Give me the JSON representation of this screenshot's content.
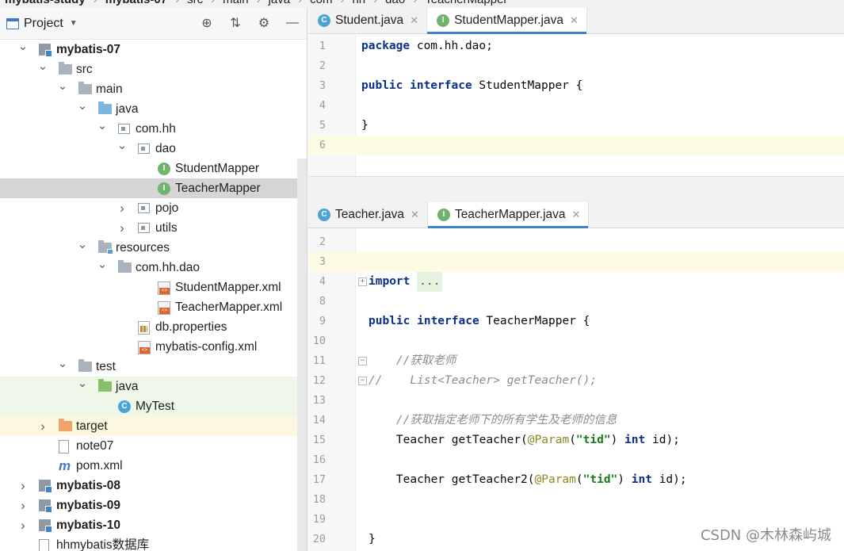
{
  "breadcrumb": [
    "mybatis-study",
    "mybatis-07",
    "src",
    "main",
    "java",
    "com",
    "hh",
    "dao",
    "TeacherMapper"
  ],
  "project_panel": {
    "title": "Project",
    "icons": [
      "window-icon",
      "locate-icon",
      "collapse-icon",
      "gear-icon",
      "minimize-icon"
    ]
  },
  "tree": [
    {
      "label": "mybatis-07",
      "depth": 0,
      "chevron": "down",
      "icon": "module",
      "bold": true
    },
    {
      "label": "src",
      "depth": 1,
      "chevron": "down",
      "icon": "folder"
    },
    {
      "label": "main",
      "depth": 2,
      "chevron": "down",
      "icon": "folder"
    },
    {
      "label": "java",
      "depth": 3,
      "chevron": "down",
      "icon": "folder-blue"
    },
    {
      "label": "com.hh",
      "depth": 4,
      "chevron": "down",
      "icon": "package"
    },
    {
      "label": "dao",
      "depth": 5,
      "chevron": "down",
      "icon": "package"
    },
    {
      "label": "StudentMapper",
      "depth": 6,
      "chevron": "",
      "icon": "interface"
    },
    {
      "label": "TeacherMapper",
      "depth": 6,
      "chevron": "",
      "icon": "interface",
      "state": "selected"
    },
    {
      "label": "pojo",
      "depth": 5,
      "chevron": "right",
      "icon": "package"
    },
    {
      "label": "utils",
      "depth": 5,
      "chevron": "right",
      "icon": "package"
    },
    {
      "label": "resources",
      "depth": 3,
      "chevron": "down",
      "icon": "folder-res"
    },
    {
      "label": "com.hh.dao",
      "depth": 4,
      "chevron": "down",
      "icon": "folder"
    },
    {
      "label": "StudentMapper.xml",
      "depth": 6,
      "chevron": "",
      "icon": "xml"
    },
    {
      "label": "TeacherMapper.xml",
      "depth": 6,
      "chevron": "",
      "icon": "xml"
    },
    {
      "label": "db.properties",
      "depth": 5,
      "chevron": "",
      "icon": "properties"
    },
    {
      "label": "mybatis-config.xml",
      "depth": 5,
      "chevron": "",
      "icon": "xml"
    },
    {
      "label": "test",
      "depth": 2,
      "chevron": "down",
      "icon": "folder"
    },
    {
      "label": "java",
      "depth": 3,
      "chevron": "down",
      "icon": "folder-green",
      "state": "test"
    },
    {
      "label": "MyTest",
      "depth": 4,
      "chevron": "",
      "icon": "class",
      "state": "test"
    },
    {
      "label": "target",
      "depth": 1,
      "chevron": "right",
      "icon": "folder-orange",
      "state": "excluded"
    },
    {
      "label": "note07",
      "depth": 1,
      "chevron": "",
      "icon": "file"
    },
    {
      "label": "pom.xml",
      "depth": 1,
      "chevron": "",
      "icon": "maven"
    },
    {
      "label": "mybatis-08",
      "depth": 0,
      "chevron": "right",
      "icon": "module",
      "bold": true
    },
    {
      "label": "mybatis-09",
      "depth": 0,
      "chevron": "right",
      "icon": "module",
      "bold": true
    },
    {
      "label": "mybatis-10",
      "depth": 0,
      "chevron": "right",
      "icon": "module",
      "bold": true
    },
    {
      "label": "hhmybatis数据库",
      "depth": 0,
      "chevron": "",
      "icon": "file"
    }
  ],
  "editor_top": {
    "tabs": [
      {
        "label": "Student.java",
        "kind": "c",
        "active": false
      },
      {
        "label": "StudentMapper.java",
        "kind": "i",
        "active": true
      }
    ],
    "lines": [
      {
        "n": "1",
        "tokens": [
          [
            "kw",
            "package"
          ],
          [
            "t",
            " com.hh.dao;"
          ]
        ]
      },
      {
        "n": "2",
        "tokens": []
      },
      {
        "n": "3",
        "tokens": [
          [
            "kw",
            "public interface"
          ],
          [
            "t",
            " StudentMapper {"
          ]
        ]
      },
      {
        "n": "4",
        "tokens": []
      },
      {
        "n": "5",
        "tokens": [
          [
            "t",
            "}"
          ]
        ]
      },
      {
        "n": "6",
        "tokens": [],
        "hl": true
      }
    ]
  },
  "editor_bottom": {
    "tabs": [
      {
        "label": "Teacher.java",
        "kind": "c",
        "active": false
      },
      {
        "label": "TeacherMapper.java",
        "kind": "i",
        "active": true
      }
    ],
    "lines": [
      {
        "n": "2",
        "tokens": []
      },
      {
        "n": "3",
        "tokens": [],
        "hl": true
      },
      {
        "n": "4",
        "tokens": [
          [
            "kw",
            "import"
          ],
          [
            "t",
            " "
          ],
          [
            "fold",
            "..."
          ]
        ],
        "fold": "+"
      },
      {
        "n": "8",
        "tokens": []
      },
      {
        "n": "9",
        "tokens": [
          [
            "kw",
            "public interface"
          ],
          [
            "t",
            " TeacherMapper {"
          ]
        ]
      },
      {
        "n": "10",
        "tokens": []
      },
      {
        "n": "11",
        "tokens": [
          [
            "t",
            "    "
          ],
          [
            "cm",
            "//获取老师"
          ]
        ],
        "fold": "-"
      },
      {
        "n": "12",
        "tokens": [
          [
            "cm",
            "//    List<Teacher> getTeacher();"
          ]
        ],
        "fold": "-"
      },
      {
        "n": "13",
        "tokens": []
      },
      {
        "n": "14",
        "tokens": [
          [
            "t",
            "    "
          ],
          [
            "cm",
            "//获取指定老师下的所有学生及老师的信息"
          ]
        ]
      },
      {
        "n": "15",
        "tokens": [
          [
            "t",
            "    Teacher getTeacher("
          ],
          [
            "an",
            "@Param"
          ],
          [
            "t",
            "("
          ],
          [
            "str",
            "\"tid\""
          ],
          [
            "t",
            ") "
          ],
          [
            "kw",
            "int"
          ],
          [
            "t",
            " id);"
          ]
        ]
      },
      {
        "n": "16",
        "tokens": []
      },
      {
        "n": "17",
        "tokens": [
          [
            "t",
            "    Teacher getTeacher2("
          ],
          [
            "an",
            "@Param"
          ],
          [
            "t",
            "("
          ],
          [
            "str",
            "\"tid\""
          ],
          [
            "t",
            ") "
          ],
          [
            "kw",
            "int"
          ],
          [
            "t",
            " id);"
          ]
        ]
      },
      {
        "n": "18",
        "tokens": []
      },
      {
        "n": "19",
        "tokens": []
      },
      {
        "n": "20",
        "tokens": [
          [
            "t",
            "}"
          ]
        ]
      }
    ]
  },
  "watermark": "CSDN @木林森屿城"
}
